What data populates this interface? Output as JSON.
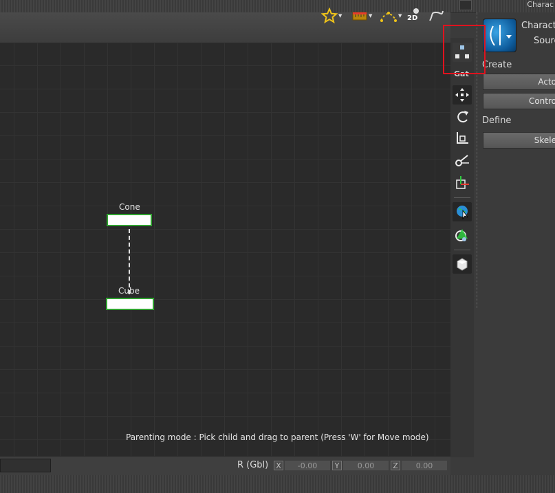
{
  "panel": {
    "title": "Charac",
    "character_line1": "Charact",
    "character_line2": "Sourc",
    "section_create": "Create",
    "btn_actor": "Acto",
    "btn_control": "Contro",
    "section_define": "Define",
    "btn_skeleton": "Skele"
  },
  "toolbar": {
    "btn_2d": "2D"
  },
  "tools": {
    "selected_label": "Gat"
  },
  "viewport": {
    "nodes": [
      {
        "label": "Cone"
      },
      {
        "label": "Cube"
      }
    ],
    "status": "Parenting mode : Pick child and drag to parent (Press 'W' for Move mode)"
  },
  "bottom": {
    "r_label": "R (Gbl)",
    "x_label": "X",
    "y_label": "Y",
    "z_label": "Z",
    "x_value": "-0.00",
    "y_value": "0.00",
    "z_value": "0.00"
  },
  "icons": [
    "star-icon",
    "ruler-icon",
    "curve-points-icon",
    "2d-view-icon",
    "path-icon",
    "parenting-icon",
    "move-icon",
    "rotate-icon",
    "scale-icon",
    "link-icon",
    "pivot-icon",
    "globe-select-icon",
    "globe-pick-icon",
    "cube-icon",
    "character-icon"
  ],
  "colors": {
    "highlight": "#e0121e",
    "node_border": "#2fa12f",
    "accent_blue": "#1f7cc6"
  }
}
